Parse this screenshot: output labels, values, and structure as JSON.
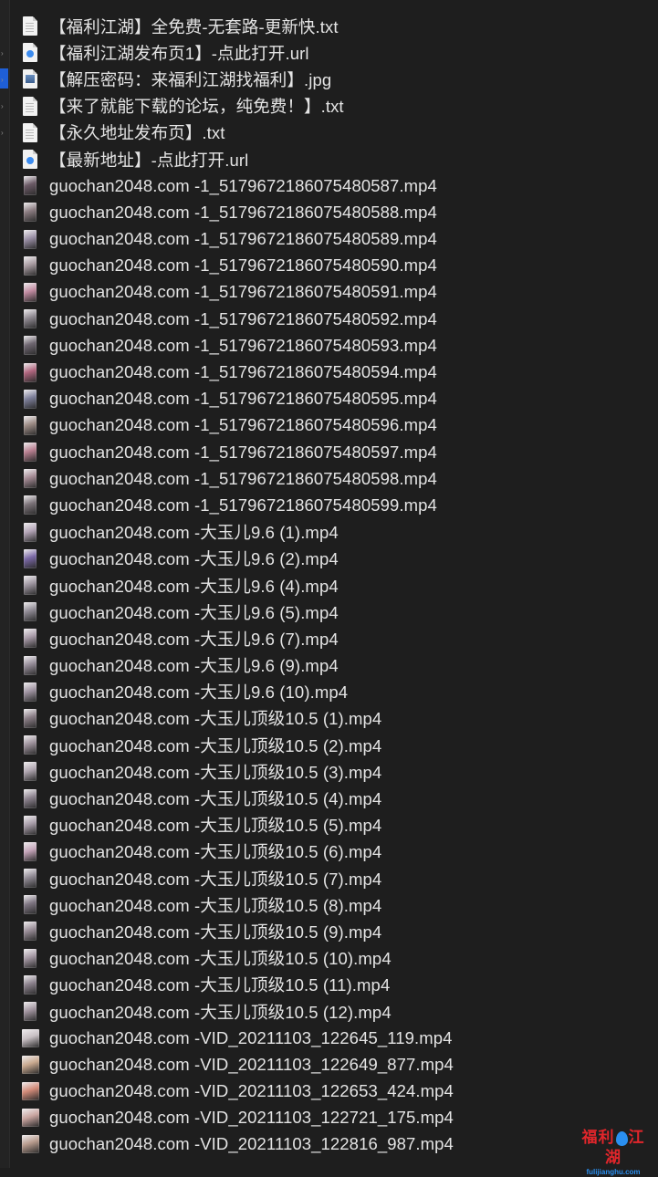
{
  "files": [
    {
      "name": "【福利江湖】全免费-无套路-更新快.txt",
      "icon": "txt-file-icon",
      "kind": "txt"
    },
    {
      "name": "【福利江湖发布页1】-点此打开.url",
      "icon": "url-file-icon",
      "kind": "url"
    },
    {
      "name": "【解压密码：来福利江湖找福利】.jpg",
      "icon": "image-file-icon",
      "kind": "img"
    },
    {
      "name": "【来了就能下载的论坛，纯免费！】.txt",
      "icon": "txt-file-icon",
      "kind": "txt"
    },
    {
      "name": "【永久地址发布页】.txt",
      "icon": "txt-file-icon",
      "kind": "txt"
    },
    {
      "name": "【最新地址】-点此打开.url",
      "icon": "url-file-icon",
      "kind": "url"
    },
    {
      "name": "guochan2048.com -1_5179672186075480587.mp4",
      "icon": "video-thumbnail-icon",
      "kind": "vid",
      "thumb": "#6b5a66"
    },
    {
      "name": "guochan2048.com -1_5179672186075480588.mp4",
      "icon": "video-thumbnail-icon",
      "kind": "vid",
      "thumb": "#8a7b80"
    },
    {
      "name": "guochan2048.com -1_5179672186075480589.mp4",
      "icon": "video-thumbnail-icon",
      "kind": "vid",
      "thumb": "#9a8fa6"
    },
    {
      "name": "guochan2048.com -1_5179672186075480590.mp4",
      "icon": "video-thumbnail-icon",
      "kind": "vid",
      "thumb": "#a79aa0"
    },
    {
      "name": "guochan2048.com -1_5179672186075480591.mp4",
      "icon": "video-thumbnail-icon",
      "kind": "vid",
      "thumb": "#c08aa0"
    },
    {
      "name": "guochan2048.com -1_5179672186075480592.mp4",
      "icon": "video-thumbnail-icon",
      "kind": "vid",
      "thumb": "#8e8890"
    },
    {
      "name": "guochan2048.com -1_5179672186075480593.mp4",
      "icon": "video-thumbnail-icon",
      "kind": "vid",
      "thumb": "#6e6670"
    },
    {
      "name": "guochan2048.com -1_5179672186075480594.mp4",
      "icon": "video-thumbnail-icon",
      "kind": "vid",
      "thumb": "#b0657e"
    },
    {
      "name": "guochan2048.com -1_5179672186075480595.mp4",
      "icon": "video-thumbnail-icon",
      "kind": "vid",
      "thumb": "#7d7f9a"
    },
    {
      "name": "guochan2048.com -1_5179672186075480596.mp4",
      "icon": "video-thumbnail-icon",
      "kind": "vid",
      "thumb": "#9b8a84"
    },
    {
      "name": "guochan2048.com -1_5179672186075480597.mp4",
      "icon": "video-thumbnail-icon",
      "kind": "vid",
      "thumb": "#b87f90"
    },
    {
      "name": "guochan2048.com -1_5179672186075480598.mp4",
      "icon": "video-thumbnail-icon",
      "kind": "vid",
      "thumb": "#a48a94"
    },
    {
      "name": "guochan2048.com -1_5179672186075480599.mp4",
      "icon": "video-thumbnail-icon",
      "kind": "vid",
      "thumb": "#7b7278"
    },
    {
      "name": "guochan2048.com -大玉儿9.6 (1).mp4",
      "icon": "video-thumbnail-icon",
      "kind": "vid",
      "thumb": "#b3a4b6"
    },
    {
      "name": "guochan2048.com -大玉儿9.6 (2).mp4",
      "icon": "video-thumbnail-icon",
      "kind": "vid",
      "thumb": "#7a68a6"
    },
    {
      "name": "guochan2048.com -大玉儿9.6 (4).mp4",
      "icon": "video-thumbnail-icon",
      "kind": "vid",
      "thumb": "#9d95a0"
    },
    {
      "name": "guochan2048.com -大玉儿9.6 (5).mp4",
      "icon": "video-thumbnail-icon",
      "kind": "vid",
      "thumb": "#8f8a94"
    },
    {
      "name": "guochan2048.com -大玉儿9.6 (7).mp4",
      "icon": "video-thumbnail-icon",
      "kind": "vid",
      "thumb": "#a89aa8"
    },
    {
      "name": "guochan2048.com -大玉儿9.6 (9).mp4",
      "icon": "video-thumbnail-icon",
      "kind": "vid",
      "thumb": "#958c98"
    },
    {
      "name": "guochan2048.com -大玉儿9.6 (10).mp4",
      "icon": "video-thumbnail-icon",
      "kind": "vid",
      "thumb": "#a094a2"
    },
    {
      "name": "guochan2048.com -大玉儿顶级10.5 (1).mp4",
      "icon": "video-thumbnail-icon",
      "kind": "vid",
      "thumb": "#8a7d86"
    },
    {
      "name": "guochan2048.com -大玉儿顶级10.5 (2).mp4",
      "icon": "video-thumbnail-icon",
      "kind": "vid",
      "thumb": "#9c909a"
    },
    {
      "name": "guochan2048.com -大玉儿顶级10.5 (3).mp4",
      "icon": "video-thumbnail-icon",
      "kind": "vid",
      "thumb": "#b0a6b0"
    },
    {
      "name": "guochan2048.com -大玉儿顶级10.5 (4).mp4",
      "icon": "video-thumbnail-icon",
      "kind": "vid",
      "thumb": "#8e8490"
    },
    {
      "name": "guochan2048.com -大玉儿顶级10.5 (5).mp4",
      "icon": "video-thumbnail-icon",
      "kind": "vid",
      "thumb": "#a79ca8"
    },
    {
      "name": "guochan2048.com -大玉儿顶级10.5 (6).mp4",
      "icon": "video-thumbnail-icon",
      "kind": "vid",
      "thumb": "#c4a4b8"
    },
    {
      "name": "guochan2048.com -大玉儿顶级10.5 (7).mp4",
      "icon": "video-thumbnail-icon",
      "kind": "vid",
      "thumb": "#908a94"
    },
    {
      "name": "guochan2048.com -大玉儿顶级10.5 (8).mp4",
      "icon": "video-thumbnail-icon",
      "kind": "vid",
      "thumb": "#7e7582"
    },
    {
      "name": "guochan2048.com -大玉儿顶级10.5 (9).mp4",
      "icon": "video-thumbnail-icon",
      "kind": "vid",
      "thumb": "#9a8e98"
    },
    {
      "name": "guochan2048.com -大玉儿顶级10.5 (10).mp4",
      "icon": "video-thumbnail-icon",
      "kind": "vid",
      "thumb": "#a497a3"
    },
    {
      "name": "guochan2048.com -大玉儿顶级10.5 (11).mp4",
      "icon": "video-thumbnail-icon",
      "kind": "vid",
      "thumb": "#8b818c"
    },
    {
      "name": "guochan2048.com -大玉儿顶级10.5 (12).mp4",
      "icon": "video-thumbnail-icon",
      "kind": "vid",
      "thumb": "#a1949f"
    },
    {
      "name": "guochan2048.com -VID_20211103_122645_119.mp4",
      "icon": "video-thumbnail-icon",
      "kind": "vid-wide",
      "thumb": "#c8c0c4"
    },
    {
      "name": "guochan2048.com -VID_20211103_122649_877.mp4",
      "icon": "video-thumbnail-icon",
      "kind": "vid-wide",
      "thumb": "#c9a98f"
    },
    {
      "name": "guochan2048.com -VID_20211103_122653_424.mp4",
      "icon": "video-thumbnail-icon",
      "kind": "vid-wide",
      "thumb": "#d28a78"
    },
    {
      "name": "guochan2048.com -VID_20211103_122721_175.mp4",
      "icon": "video-thumbnail-icon",
      "kind": "vid-wide",
      "thumb": "#c9a5a0"
    },
    {
      "name": "guochan2048.com -VID_20211103_122816_987.mp4",
      "icon": "video-thumbnail-icon",
      "kind": "vid-wide",
      "thumb": "#b79a8c"
    }
  ],
  "watermark": {
    "text_left": "福利",
    "text_right": "江湖",
    "domain": "fulijianghu.com"
  },
  "colors": {
    "background": "#1e1e1e",
    "text": "#e4e4e4",
    "selection": "#1f5fd6",
    "watermark_red": "#e2262b",
    "watermark_blue": "#2a8ff0"
  }
}
